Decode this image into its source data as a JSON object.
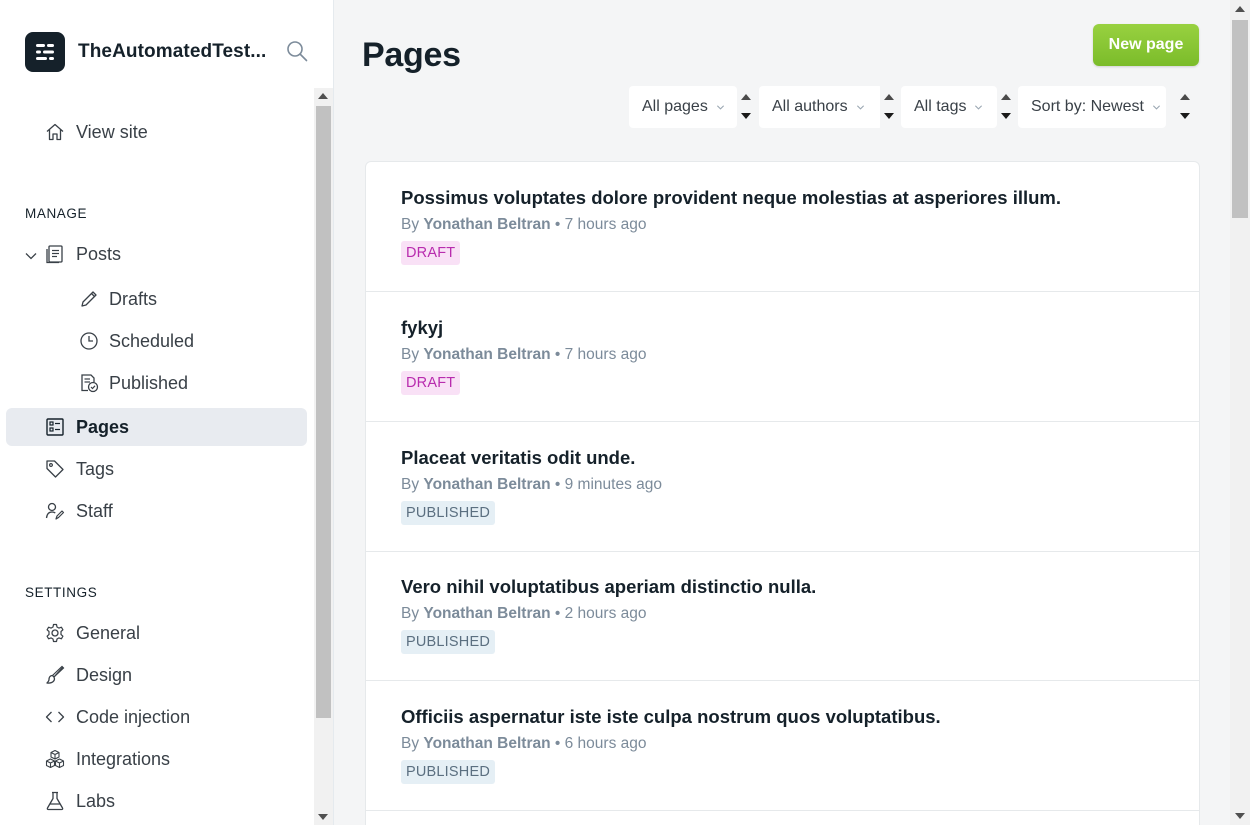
{
  "brand": {
    "name": "TheAutomatedTest..."
  },
  "sidebar": {
    "view_site": "View site",
    "manage_title": "MANAGE",
    "posts": "Posts",
    "drafts": "Drafts",
    "scheduled": "Scheduled",
    "published": "Published",
    "pages": "Pages",
    "tags": "Tags",
    "staff": "Staff",
    "settings_title": "SETTINGS",
    "general": "General",
    "design": "Design",
    "code_injection": "Code injection",
    "integrations": "Integrations",
    "labs": "Labs"
  },
  "header": {
    "title": "Pages",
    "new_button": "New page",
    "filters": {
      "type": "All pages",
      "authors": "All authors",
      "tags": "All tags",
      "sort": "Sort by: Newest"
    }
  },
  "pages": [
    {
      "title": "Possimus voluptates dolore provident neque molestias at asperiores illum.",
      "by": "By",
      "author": "Yonathan Beltran",
      "time": "• 7 hours ago",
      "status": "DRAFT"
    },
    {
      "title": "fykyj",
      "by": "By",
      "author": "Yonathan Beltran",
      "time": "• 7 hours ago",
      "status": "DRAFT"
    },
    {
      "title": "Placeat veritatis odit unde.",
      "by": "By",
      "author": "Yonathan Beltran",
      "time": "• 9 minutes ago",
      "status": "PUBLISHED"
    },
    {
      "title": "Vero nihil voluptatibus aperiam distinctio nulla.",
      "by": "By",
      "author": "Yonathan Beltran",
      "time": "• 2 hours ago",
      "status": "PUBLISHED"
    },
    {
      "title": "Officiis aspernatur iste iste culpa nostrum quos voluptatibus.",
      "by": "By",
      "author": "Yonathan Beltran",
      "time": "• 6 hours ago",
      "status": "PUBLISHED"
    }
  ],
  "colors": {
    "accent_green": "#86c338",
    "draft_badge_bg": "#f9e1f6",
    "draft_badge_text": "#b82cae",
    "published_badge_bg": "#e5eff5",
    "published_badge_text": "#5b6f80",
    "active_nav_bg": "#e8ebf0"
  },
  "icons": {
    "brand": "ghost-logo-icon",
    "search": "search-icon",
    "view_site": "home-icon",
    "posts": "document-icon",
    "drafts": "pencil-icon",
    "scheduled": "clock-icon",
    "published": "document-check-icon",
    "pages": "page-grid-icon",
    "tags": "tag-icon",
    "staff": "user-icon",
    "general": "gear-icon",
    "design": "brush-icon",
    "code_injection": "code-icon",
    "integrations": "cubes-icon",
    "labs": "flask-icon"
  }
}
